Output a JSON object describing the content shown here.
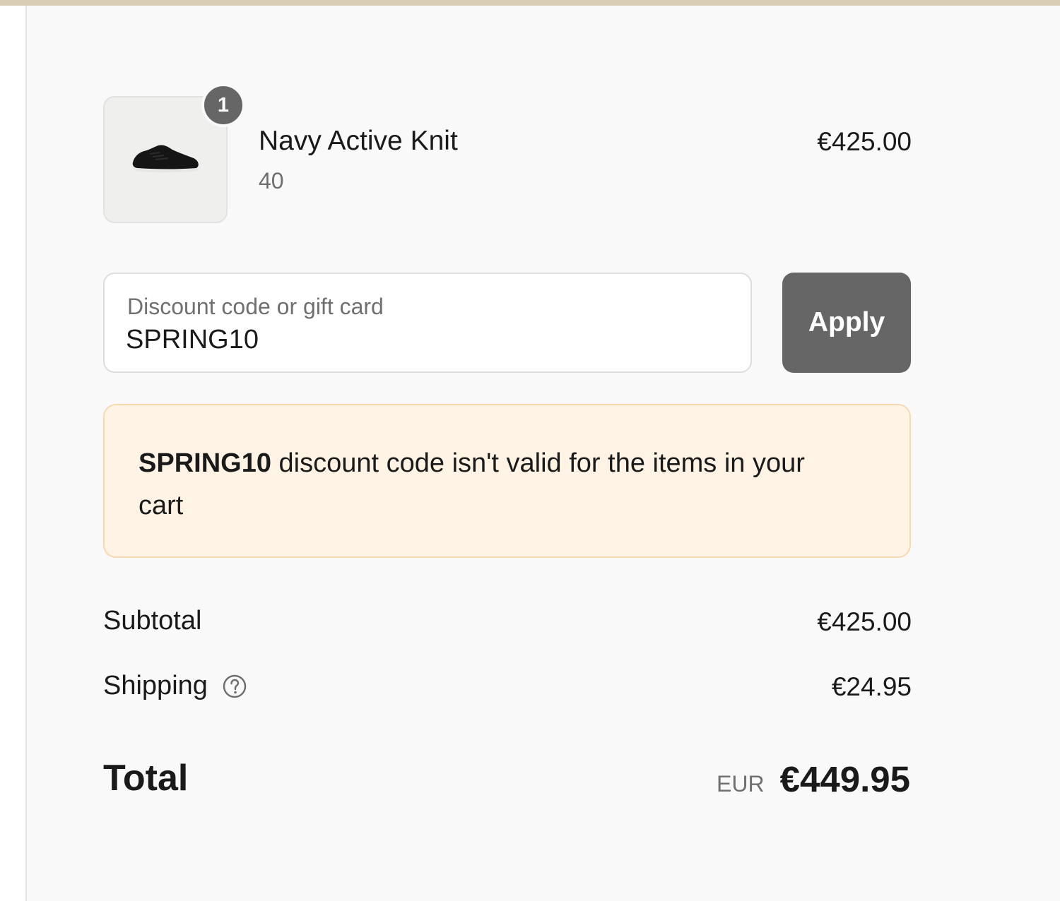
{
  "colors": {
    "top_bar": "#d8cdb4",
    "panel_background": "#f9f9f9",
    "badge": "#666666",
    "apply_button": "#666666",
    "warning_background": "#fff3e6",
    "warning_border": "#f7d8b0"
  },
  "line_item": {
    "image_icon": "black-sneaker",
    "quantity": "1",
    "name": "Navy Active Knit",
    "variant": "40",
    "price": "€425.00"
  },
  "discount": {
    "label": "Discount code or gift card",
    "value": "SPRING10",
    "apply_label": "Apply"
  },
  "warning": {
    "code": "SPRING10",
    "message": " discount code isn't valid for the items in your cart"
  },
  "summary": {
    "subtotal_label": "Subtotal",
    "subtotal_value": "€425.00",
    "shipping_label": "Shipping",
    "shipping_help_icon": "question-circle",
    "shipping_value": "€24.95",
    "total_label": "Total",
    "currency": "EUR",
    "total_value": "€449.95"
  }
}
